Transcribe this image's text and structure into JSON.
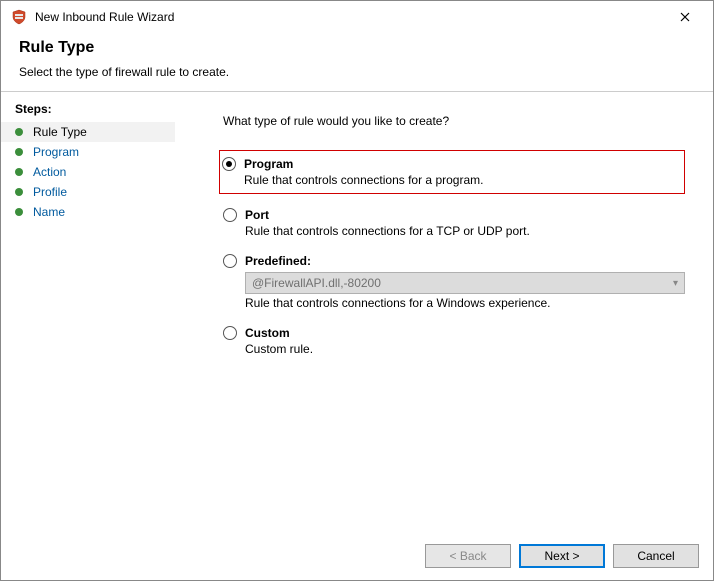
{
  "window": {
    "title": "New Inbound Rule Wizard"
  },
  "header": {
    "title": "Rule Type",
    "subtitle": "Select the type of firewall rule to create."
  },
  "sidebar": {
    "heading": "Steps:",
    "items": [
      {
        "label": "Rule Type"
      },
      {
        "label": "Program"
      },
      {
        "label": "Action"
      },
      {
        "label": "Profile"
      },
      {
        "label": "Name"
      }
    ]
  },
  "main": {
    "question": "What type of rule would you like to create?",
    "options": {
      "program": {
        "label": "Program",
        "desc": "Rule that controls connections for a program."
      },
      "port": {
        "label": "Port",
        "desc": "Rule that controls connections for a TCP or UDP port."
      },
      "predef": {
        "label": "Predefined:",
        "desc": "Rule that controls connections for a Windows experience.",
        "select_value": "@FirewallAPI.dll,-80200"
      },
      "custom": {
        "label": "Custom",
        "desc": "Custom rule."
      }
    }
  },
  "footer": {
    "back": "< Back",
    "next": "Next >",
    "cancel": "Cancel"
  }
}
